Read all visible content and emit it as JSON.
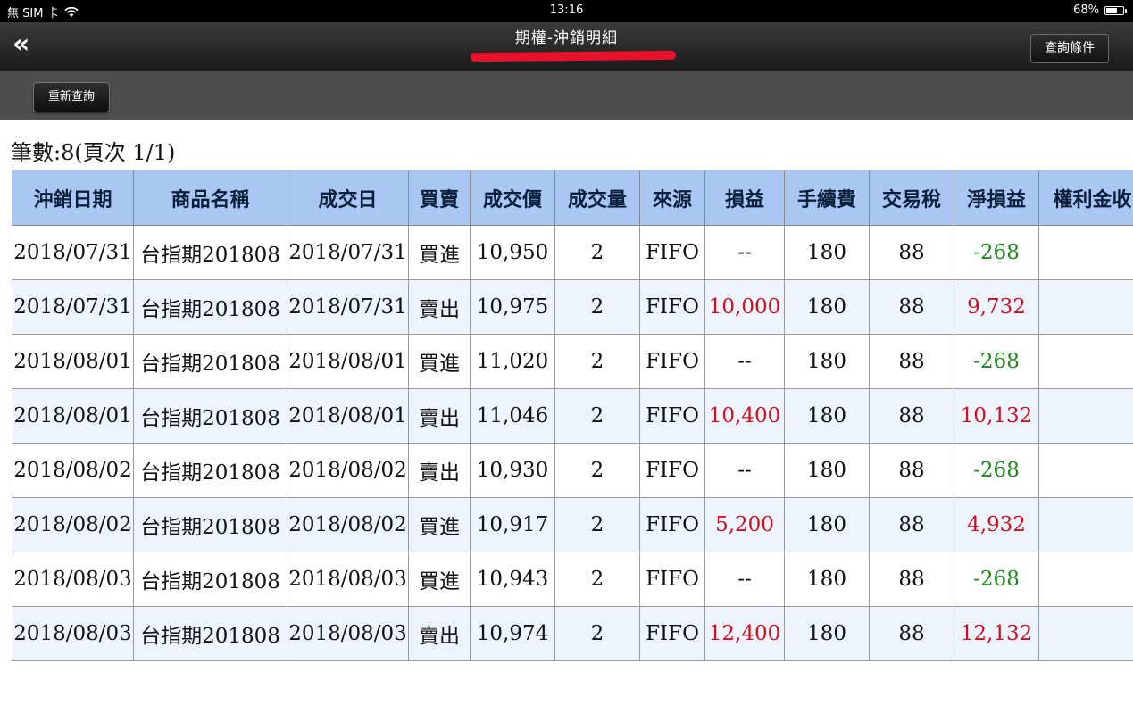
{
  "status_bar": {
    "carrier": "無 SIM 卡",
    "time": "13:16",
    "battery": "68%",
    "battery_level": 0.68
  },
  "nav": {
    "back_label": "«",
    "title": "期權-沖銷明細",
    "query_button": "查詢條件"
  },
  "toolbar": {
    "requery_button": "重新查詢"
  },
  "record_count": "筆數:8(頁次 1/1)",
  "colors": {
    "header_bg": "#a9c7f2",
    "profit": "#d0101a",
    "loss": "#1e8a1e"
  },
  "table": {
    "headers": [
      "沖銷日期",
      "商品名稱",
      "成交日",
      "買賣",
      "成交價",
      "成交量",
      "來源",
      "損益",
      "手續費",
      "交易稅",
      "淨損益",
      "權利金收"
    ],
    "rows": [
      {
        "cells": [
          "2018/07/31",
          "台指期201808",
          "2018/07/31",
          "買進",
          "10,950",
          "2",
          "FIFO",
          "--",
          "180",
          "88",
          "-268",
          ""
        ],
        "pl": "plain",
        "net": "neg"
      },
      {
        "cells": [
          "2018/07/31",
          "台指期201808",
          "2018/07/31",
          "賣出",
          "10,975",
          "2",
          "FIFO",
          "10,000",
          "180",
          "88",
          "9,732",
          ""
        ],
        "pl": "pos",
        "net": "pos"
      },
      {
        "cells": [
          "2018/08/01",
          "台指期201808",
          "2018/08/01",
          "買進",
          "11,020",
          "2",
          "FIFO",
          "--",
          "180",
          "88",
          "-268",
          ""
        ],
        "pl": "plain",
        "net": "neg"
      },
      {
        "cells": [
          "2018/08/01",
          "台指期201808",
          "2018/08/01",
          "賣出",
          "11,046",
          "2",
          "FIFO",
          "10,400",
          "180",
          "88",
          "10,132",
          ""
        ],
        "pl": "pos",
        "net": "pos"
      },
      {
        "cells": [
          "2018/08/02",
          "台指期201808",
          "2018/08/02",
          "賣出",
          "10,930",
          "2",
          "FIFO",
          "--",
          "180",
          "88",
          "-268",
          ""
        ],
        "pl": "plain",
        "net": "neg"
      },
      {
        "cells": [
          "2018/08/02",
          "台指期201808",
          "2018/08/02",
          "買進",
          "10,917",
          "2",
          "FIFO",
          "5,200",
          "180",
          "88",
          "4,932",
          ""
        ],
        "pl": "pos",
        "net": "pos"
      },
      {
        "cells": [
          "2018/08/03",
          "台指期201808",
          "2018/08/03",
          "買進",
          "10,943",
          "2",
          "FIFO",
          "--",
          "180",
          "88",
          "-268",
          ""
        ],
        "pl": "plain",
        "net": "neg"
      },
      {
        "cells": [
          "2018/08/03",
          "台指期201808",
          "2018/08/03",
          "賣出",
          "10,974",
          "2",
          "FIFO",
          "12,400",
          "180",
          "88",
          "12,132",
          ""
        ],
        "pl": "pos",
        "net": "pos"
      }
    ]
  }
}
